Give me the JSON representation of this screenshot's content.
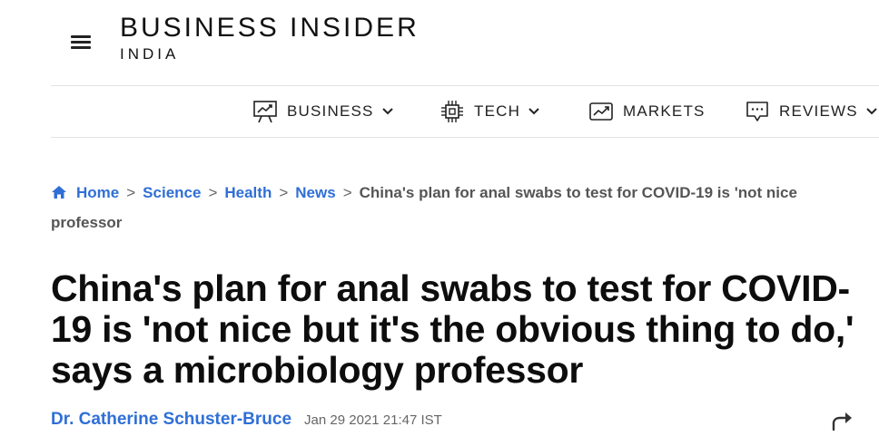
{
  "header": {
    "brand_name": "BUSINESS INSIDER",
    "brand_edition": "INDIA"
  },
  "nav": {
    "items": [
      {
        "label": "BUSINESS",
        "icon": "presentation-chart-icon",
        "has_dropdown": true
      },
      {
        "label": "TECH",
        "icon": "chip-icon",
        "has_dropdown": true
      },
      {
        "label": "MARKETS",
        "icon": "trend-chart-icon",
        "has_dropdown": false
      },
      {
        "label": "REVIEWS",
        "icon": "chat-bubble-icon",
        "has_dropdown": true
      }
    ]
  },
  "breadcrumb": {
    "items": [
      {
        "label": "Home",
        "icon": "home-icon"
      },
      {
        "label": "Science"
      },
      {
        "label": "Health"
      },
      {
        "label": "News"
      }
    ],
    "current_line1": "China's plan for anal swabs to test for COVID-19 is 'not nice",
    "current_line2": "professor"
  },
  "article": {
    "headline": "China's plan for anal swabs to test for COVID-19 is 'not nice but it's the obvious thing to do,' says a microbiology professor",
    "author": "Dr. Catherine Schuster-Bruce",
    "date": "Jan 29 2021 21:47 IST"
  },
  "colors": {
    "link": "#2f6fd6",
    "text": "#111111",
    "muted": "#555555"
  }
}
